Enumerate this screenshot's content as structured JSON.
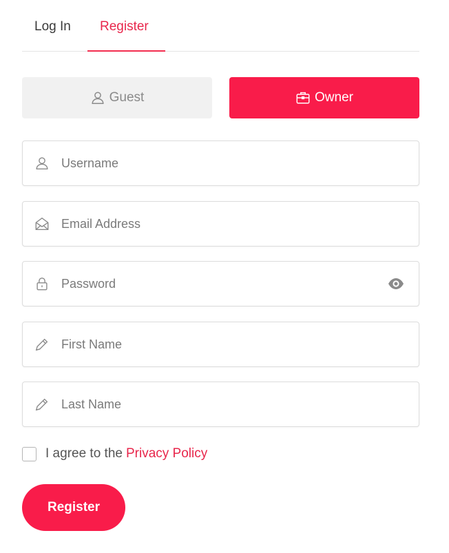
{
  "tabs": {
    "login_label": "Log In",
    "register_label": "Register",
    "active": "register"
  },
  "roles": {
    "guest_label": "Guest",
    "owner_label": "Owner",
    "selected": "owner"
  },
  "fields": {
    "username_placeholder": "Username",
    "email_placeholder": "Email Address",
    "password_placeholder": "Password",
    "first_name_placeholder": "First Name",
    "last_name_placeholder": "Last Name"
  },
  "agreement": {
    "prefix": "I agree to the",
    "link_text": "Privacy Policy",
    "checked": false
  },
  "submit": {
    "label": "Register"
  },
  "colors": {
    "accent": "#f91c4a",
    "accent_text": "#e8264b",
    "guest_bg": "#f1f1f1"
  },
  "icons": {
    "guest": "user-icon",
    "owner": "briefcase-icon",
    "username": "user-icon",
    "email": "envelope-open-icon",
    "password": "lock-icon",
    "first_name": "pencil-icon",
    "last_name": "pencil-icon",
    "toggle_password": "eye-icon"
  }
}
